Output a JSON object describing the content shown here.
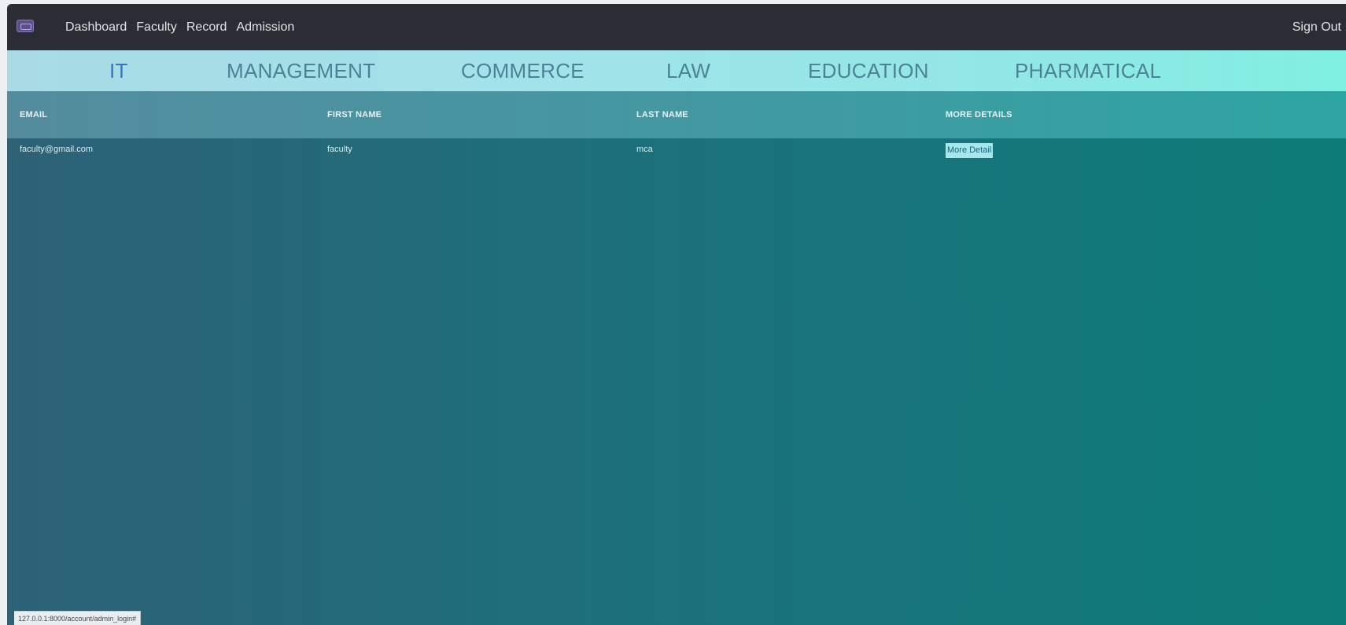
{
  "navbar": {
    "logo_icon": "logo-icon",
    "links": [
      "Dashboard",
      "Faculty",
      "Record",
      "Admission"
    ],
    "signout_label": "Sign Out"
  },
  "tabs": [
    {
      "label": "IT",
      "active": true
    },
    {
      "label": "MANAGEMENT",
      "active": false
    },
    {
      "label": "COMMERCE",
      "active": false
    },
    {
      "label": "LAW",
      "active": false
    },
    {
      "label": "EDUCATION",
      "active": false
    },
    {
      "label": "PHARMATICAL",
      "active": false
    }
  ],
  "table": {
    "headers": [
      "EMAIL",
      "FIRST NAME",
      "LAST NAME",
      "MORE DETAILS"
    ],
    "rows": [
      {
        "email": "faculty@gmail.com",
        "first_name": "faculty",
        "last_name": "mca",
        "more": "More Detail"
      }
    ]
  },
  "status_url": "127.0.0.1:8000/account/admin_login#",
  "colors": {
    "navbar": "#2a2e34",
    "active_tab": "#3b73c9",
    "tab_text": "#4c8295",
    "table_bg_start": "#2d6277",
    "table_bg_end": "#0d7b78"
  }
}
